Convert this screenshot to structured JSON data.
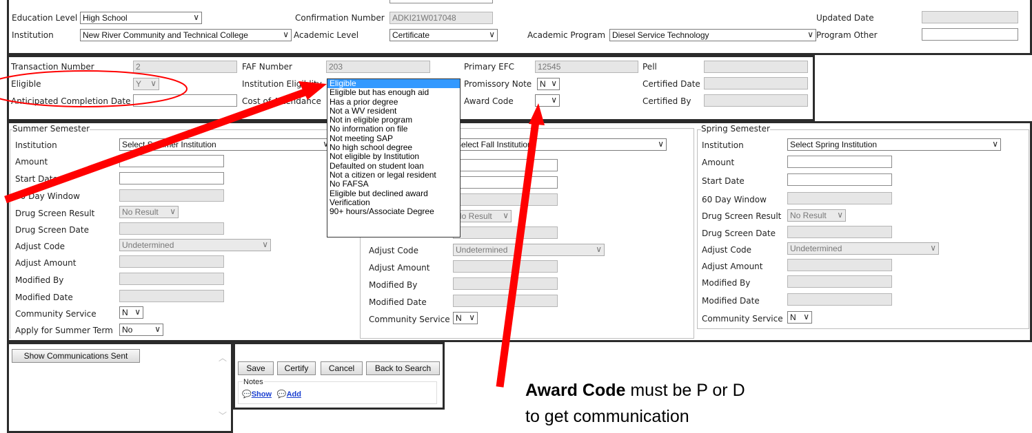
{
  "top": {
    "education_level_label": "Education Level",
    "education_level_value": "High School",
    "confirmation_label": "Confirmation Number",
    "confirmation_value": "ADKI21W017048",
    "updated_date_label": "Updated Date",
    "institution_label": "Institution",
    "institution_value": "New River Community and Technical College",
    "academic_level_label": "Academic Level",
    "academic_level_value": "Certificate",
    "academic_program_label": "Academic Program",
    "academic_program_value": "Diesel Service Technology",
    "program_other_label": "Program Other"
  },
  "award": {
    "transaction_label": "Transaction Number",
    "transaction_value": "2",
    "faf_label": "FAF Number",
    "faf_value": "203",
    "primary_efc_label": "Primary EFC",
    "primary_efc_value": "12545",
    "pell_label": "Pell",
    "eligible_label": "Eligible",
    "eligible_value": "Y",
    "inst_elig_label": "Institution Eligiblity",
    "promissory_label": "Promissory Note",
    "promissory_value": "N",
    "certified_date_label": "Certified Date",
    "anticipated_label": "Anticipated Completion Date",
    "cost_label": "Cost of Attendance",
    "award_code_label": "Award Code",
    "award_code_value": "",
    "certified_by_label": "Certified By"
  },
  "dropdown": {
    "options": [
      "Eligible",
      "Eligible but has enough aid",
      "Has a prior degree",
      "Not a WV resident",
      "Not in eligible program",
      "No information on file",
      "Not meeting SAP",
      "No high school degree",
      "Not eligible by Institution",
      "Defaulted on student loan",
      "Not a citizen or legal resident",
      "No FAFSA",
      "Eligible but declined award",
      "Verification",
      "90+ hours/Associate Degree"
    ],
    "selected": "Eligible"
  },
  "summer": {
    "title": "Summer Semester",
    "institution_label": "Institution",
    "institution_value": "Select Summer Institution",
    "amount_label": "Amount",
    "start_date_label": "Start Date",
    "window_label": "60 Day Window",
    "drug_result_label": "Drug Screen Result",
    "drug_result_value": "No Result",
    "drug_date_label": "Drug Screen Date",
    "adjust_code_label": "Adjust Code",
    "adjust_code_value": "Undetermined",
    "adjust_amount_label": "Adjust Amount",
    "modified_by_label": "Modified By",
    "modified_date_label": "Modified Date",
    "community_label": "Community Service",
    "community_value": "N",
    "apply_label": "Apply for Summer Term",
    "apply_value": "No"
  },
  "fall": {
    "institution_value": "Select Fall Institution",
    "drug_result_value": "No Result",
    "adjust_code_label": "Adjust Code",
    "adjust_code_value": "Undetermined",
    "adjust_amount_label": "Adjust Amount",
    "modified_by_label": "Modified By",
    "modified_date_label": "Modified Date",
    "community_label": "Community Service",
    "community_value": "N"
  },
  "spring": {
    "title": "Spring Semester",
    "institution_label": "Institution",
    "institution_value": "Select Spring Institution",
    "amount_label": "Amount",
    "start_date_label": "Start Date",
    "window_label": "60 Day Window",
    "drug_result_label": "Drug Screen Result",
    "drug_result_value": "No Result",
    "drug_date_label": "Drug Screen Date",
    "adjust_code_label": "Adjust Code",
    "adjust_code_value": "Undetermined",
    "adjust_amount_label": "Adjust Amount",
    "modified_by_label": "Modified By",
    "modified_date_label": "Modified Date",
    "community_label": "Community Service",
    "community_value": "N"
  },
  "actions": {
    "show_comms": "Show Communications Sent",
    "save": "Save",
    "certify": "Certify",
    "cancel": "Cancel",
    "back": "Back to Search",
    "notes_label": "Notes",
    "show_link": "Show",
    "add_link": "Add"
  },
  "annotation": {
    "bold": "Award Code",
    "rest_line1": " must be P or D",
    "line2": "to get communication"
  },
  "colors": {
    "arrow": "#ff0000",
    "selected_option": "#3399ff",
    "panel_border": "#2b2b2b",
    "readonly_field": "#e6e6e6"
  }
}
